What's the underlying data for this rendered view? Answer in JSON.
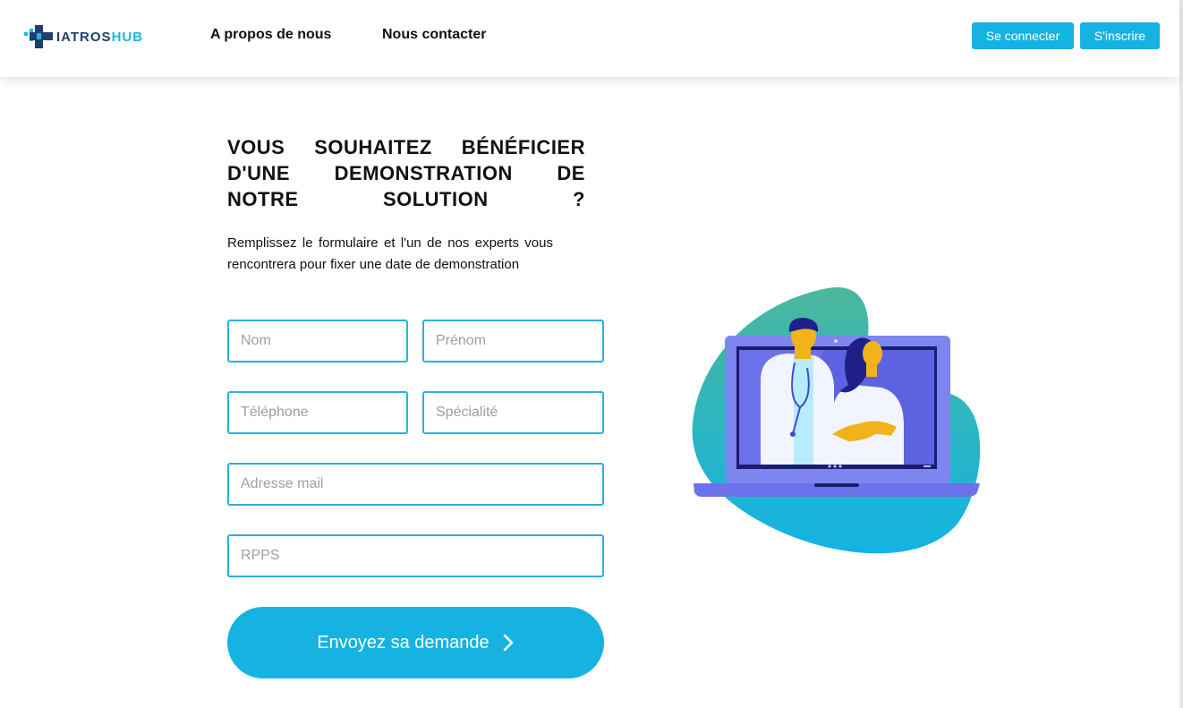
{
  "header": {
    "logo": {
      "part1": "IATROS",
      "part2": "HUB"
    },
    "nav": [
      {
        "label": "A propos de nous"
      },
      {
        "label": "Nous contacter"
      }
    ],
    "buttons": {
      "login": "Se connecter",
      "signup": "S'inscrire"
    }
  },
  "main": {
    "title": "VOUS SOUHAITEZ BÉNÉFICIER D'UNE DEMONSTRATION DE NOTRE SOLUTION ?",
    "subtitle": "Remplissez le formulaire et l'un de nos experts vous rencontrera pour fixer une date de demonstration",
    "form": {
      "nom_placeholder": "Nom",
      "prenom_placeholder": "Prénom",
      "telephone_placeholder": "Téléphone",
      "specialite_placeholder": "Spécialité",
      "email_placeholder": "Adresse mail",
      "rpps_placeholder": "RPPS",
      "submit_label": "Envoyez sa demande"
    }
  },
  "colors": {
    "accent": "#16b3e2",
    "border": "#27b2dd",
    "logo_dark": "#1f3f6e"
  },
  "icons": {
    "submit_chevron": "chevron-right-icon",
    "illustration": "doctors-laptop-illustration"
  }
}
